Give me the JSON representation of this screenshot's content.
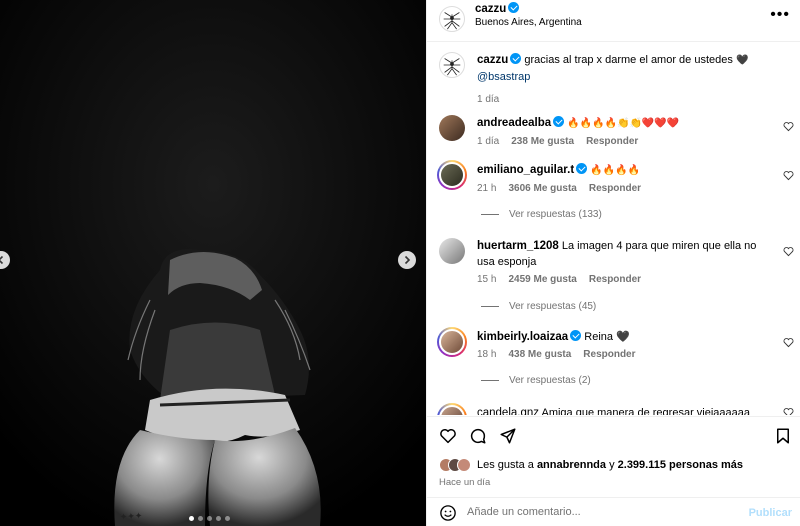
{
  "post": {
    "username": "cazzu",
    "location": "Buenos Aires, Argentina",
    "caption_user": "cazzu",
    "caption_text": "gracias al trap x darme el amor de ustedes",
    "caption_emoji": "🖤",
    "caption_mention": "@bsastrap",
    "caption_time": "1 día",
    "more_icon": "more-options-icon"
  },
  "comments": [
    {
      "user": "andreadealba",
      "verified": true,
      "text": "🔥🔥🔥🔥👏👏❤️❤️❤️",
      "time": "1 día",
      "likes": "238 Me gusta",
      "reply": "Responder",
      "replies": ""
    },
    {
      "user": "emiliano_aguilar.t",
      "verified": true,
      "text": "🔥🔥🔥🔥",
      "time": "21 h",
      "likes": "3606 Me gusta",
      "reply": "Responder",
      "replies": "Ver respuestas (133)"
    },
    {
      "user": "huertarm_1208",
      "verified": false,
      "text": "La imagen 4 para que miren que ella no usa esponja",
      "time": "15 h",
      "likes": "2459 Me gusta",
      "reply": "Responder",
      "replies": "Ver respuestas (45)"
    },
    {
      "user": "kimbeirly.loaizaa",
      "verified": true,
      "text": "Reina 🖤",
      "time": "18 h",
      "likes": "438 Me gusta",
      "reply": "Responder",
      "replies": "Ver respuestas (2)"
    },
    {
      "user": "candela.gnz",
      "verified": false,
      "text": "Amiga que manera de regresar viejaaaaaa",
      "time": "",
      "likes": "",
      "reply": "",
      "replies": ""
    }
  ],
  "likes": {
    "prefix": "Les gusta a",
    "user": "annabrennda",
    "connector": "y",
    "count": "2.399.115 personas más"
  },
  "date": "Hace un día",
  "add_comment": {
    "placeholder": "Añade un comentario...",
    "publish": "Publicar"
  },
  "carousel": {
    "count": 5,
    "active": 1
  },
  "colors": {
    "accent": "#0095f6",
    "muted": "#737373",
    "publish_disabled": "#b2dffc",
    "like_red": "#ed4956"
  }
}
